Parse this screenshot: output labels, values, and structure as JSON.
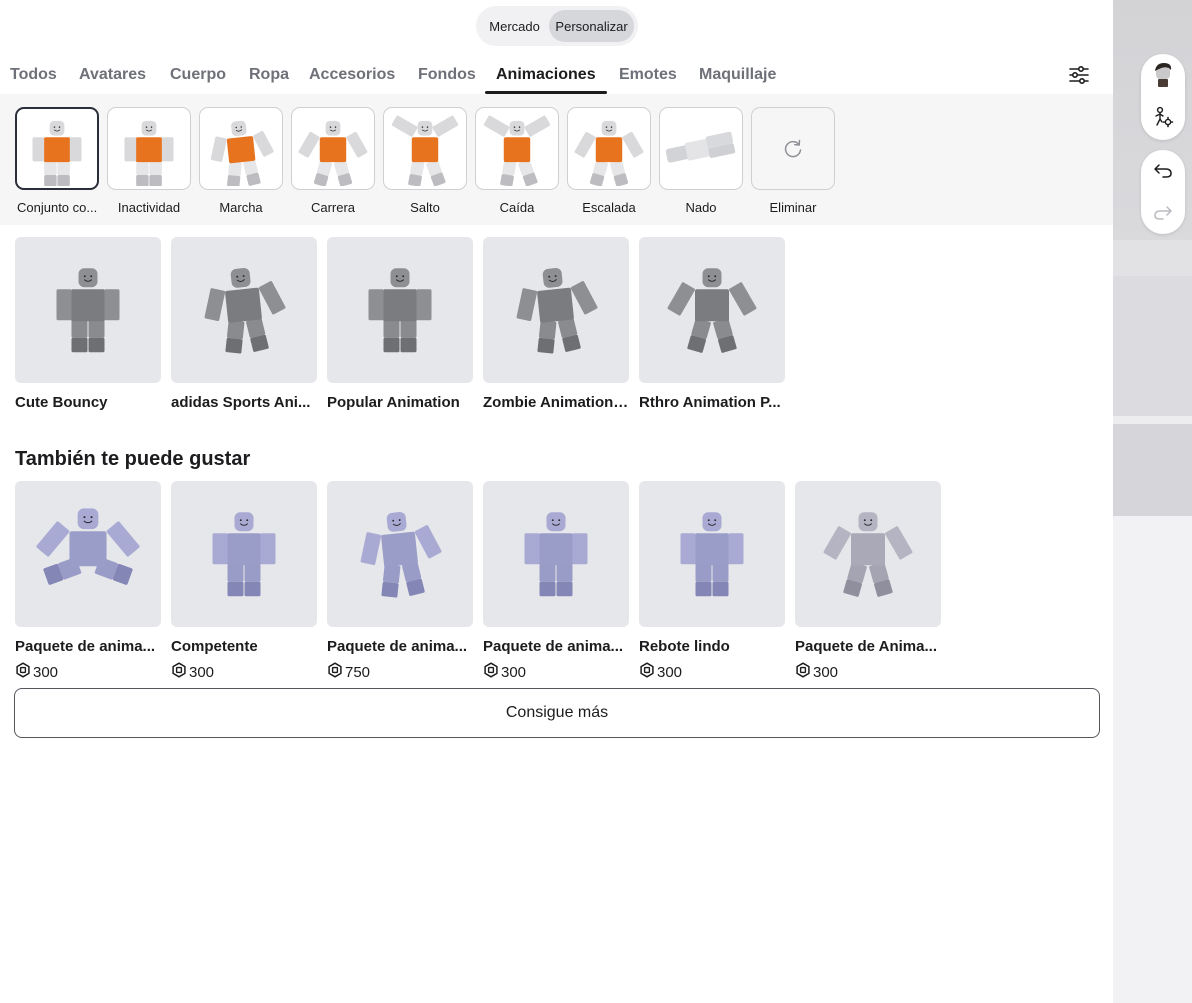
{
  "toggle": {
    "marketplace": "Mercado",
    "customize": "Personalizar"
  },
  "tabs": [
    "Todos",
    "Avatares",
    "Cuerpo",
    "Ropa",
    "Accesorios",
    "Fondos",
    "Animaciones",
    "Emotes",
    "Maquillaje"
  ],
  "active_tab": "Animaciones",
  "slots": [
    {
      "label": "Conjunto co...",
      "selected": true
    },
    {
      "label": "Inactividad"
    },
    {
      "label": "Marcha"
    },
    {
      "label": "Carrera"
    },
    {
      "label": "Salto"
    },
    {
      "label": "Caída"
    },
    {
      "label": "Escalada"
    },
    {
      "label": "Nado"
    },
    {
      "label": "Eliminar",
      "icon": "refresh-icon"
    }
  ],
  "owned": [
    {
      "name": "Cute Bouncy"
    },
    {
      "name": "adidas Sports Ani..."
    },
    {
      "name": "Popular Animation"
    },
    {
      "name": "Zombie Animation ..."
    },
    {
      "name": "Rthro Animation P..."
    }
  ],
  "recommend": {
    "title": "También te puede gustar",
    "items": [
      {
        "name": "Paquete de anima...",
        "price": "300"
      },
      {
        "name": "Competente",
        "price": "300"
      },
      {
        "name": "Paquete de anima...",
        "price": "750"
      },
      {
        "name": "Paquete de anima...",
        "price": "300"
      },
      {
        "name": "Rebote lindo",
        "price": "300"
      },
      {
        "name": "Paquete de Anima...",
        "price": "300"
      }
    ]
  },
  "get_more": "Consigue más",
  "colors": {
    "accent": "#1c1c1e",
    "orange": "#e8731f",
    "lavender": "#9b9dc9",
    "gray_figure": "#7b7c80"
  },
  "icons": {
    "currency": "robux-icon",
    "filter": "sliders-icon",
    "undo": "undo-icon",
    "redo": "redo-icon"
  }
}
